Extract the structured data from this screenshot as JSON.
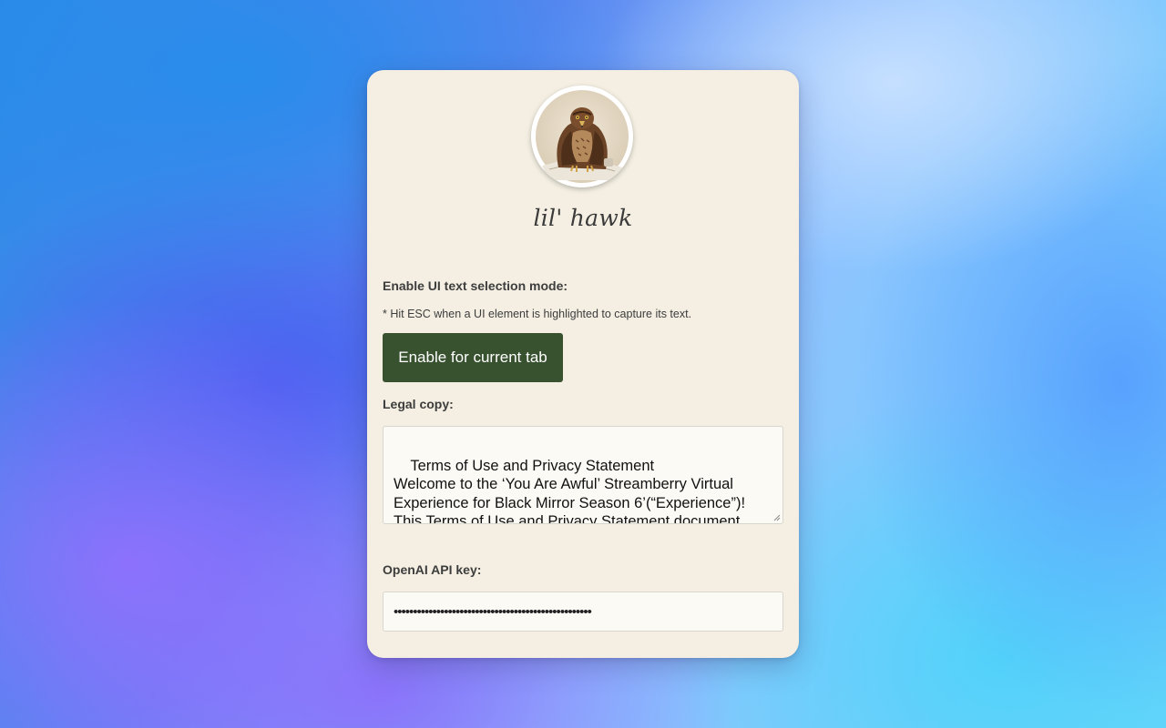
{
  "app": {
    "name": "lil' hawk",
    "avatar_icon": "hawk-avatar-icon"
  },
  "selection": {
    "heading": "Enable UI text selection mode:",
    "hint": "* Hit ESC when a UI element is highlighted to capture its text.",
    "button_label": "Enable for current tab"
  },
  "legal": {
    "heading": "Legal copy:",
    "text": "Terms of Use and Privacy Statement\nWelcome to the ‘You Are Awful’ Streamberry Virtual Experience for Black Mirror Season 6’(“Experience”)! This Terms of Use and Privacy Statement document (“Terms”) explains our"
  },
  "api": {
    "heading": "OpenAI API key:",
    "masked_value": "•••••••••••••••••••••••••••••••••••••••••••••••••••"
  },
  "colors": {
    "card_bg": "#f4efe2",
    "button_bg": "#38512f",
    "field_bg": "#fbfaf5"
  }
}
